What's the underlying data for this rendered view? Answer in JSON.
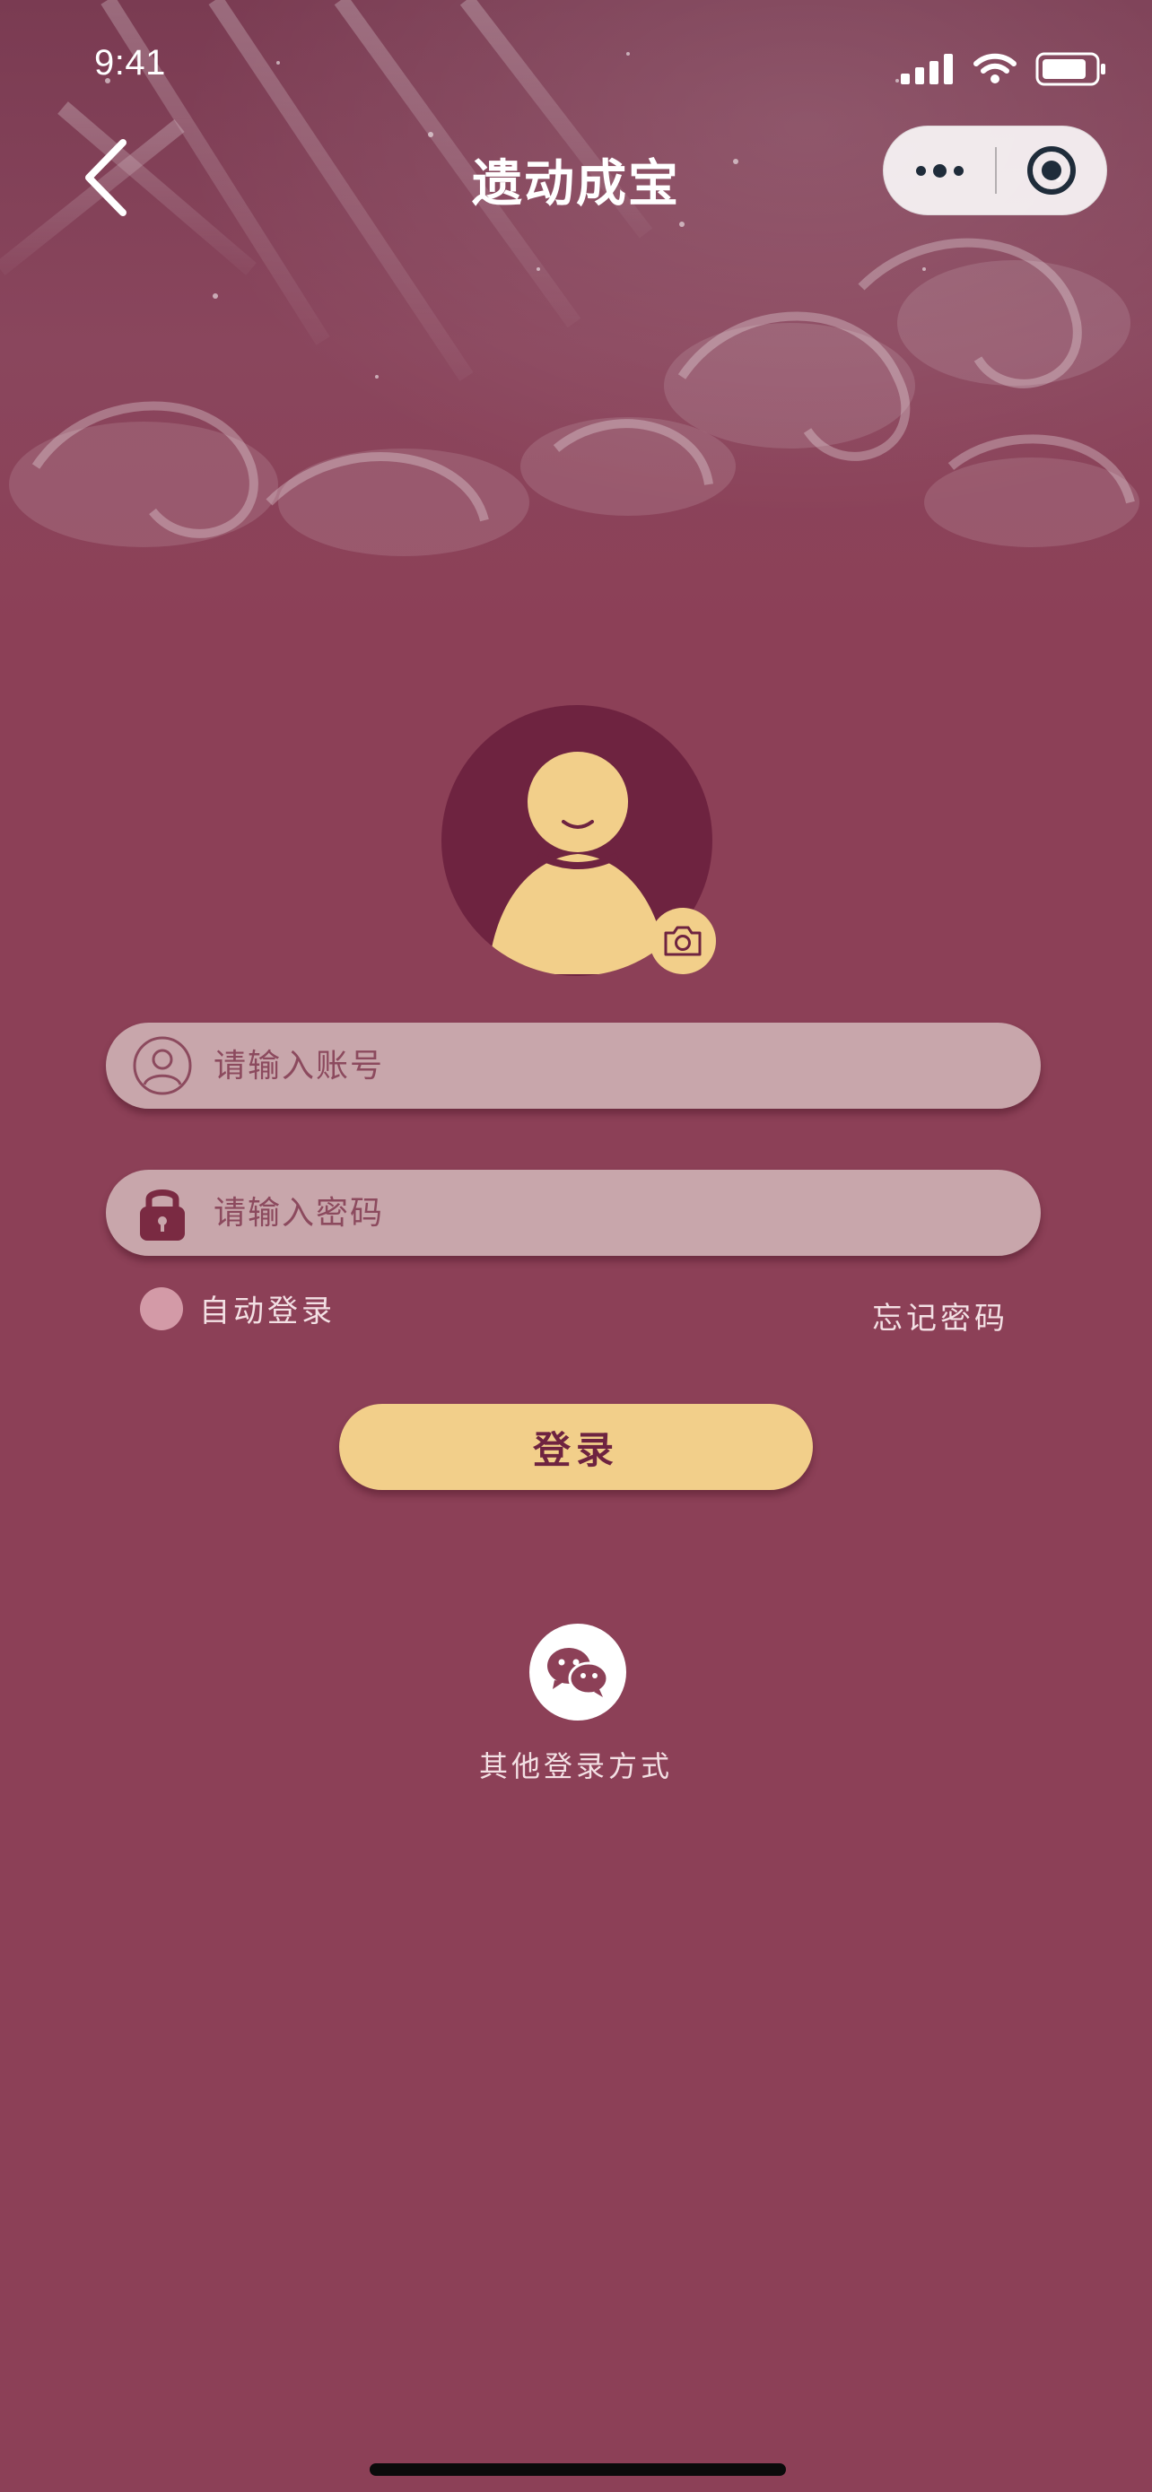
{
  "status_bar": {
    "time": "9:41"
  },
  "nav": {
    "title": "遗动成宝"
  },
  "form": {
    "account_placeholder": "请输入账号",
    "password_placeholder": "请输入密码",
    "auto_login_label": "自动登录",
    "forgot_password_label": "忘记密码",
    "login_button_label": "登录"
  },
  "other_login": {
    "label": "其他登录方式"
  },
  "colors": {
    "background": "#8c4057",
    "accent_gold": "#f2cf8a",
    "avatar_bg": "#6e2340",
    "field_bg": "#c8a6ab"
  },
  "icons": {
    "back": "chevron-left-icon",
    "capsule_more": "more-icon",
    "capsule_close": "target-icon",
    "camera": "camera-icon",
    "account": "user-circle-icon",
    "password": "lock-icon",
    "wechat": "wechat-icon"
  }
}
